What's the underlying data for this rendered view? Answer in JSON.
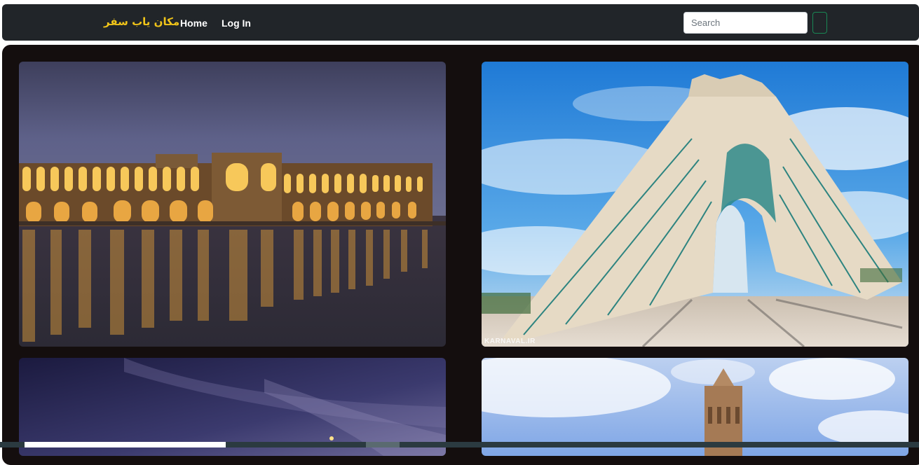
{
  "navbar": {
    "brand": "مکان یاب سفر",
    "links": [
      "Home",
      "Log In"
    ],
    "search": {
      "placeholder": "Search",
      "value": ""
    }
  },
  "gallery": {
    "cards": [
      {
        "icon": "si-o-se-pol-bridge-photo"
      },
      {
        "icon": "azadi-tower-photo",
        "watermark": "KARNAVAL.IR"
      },
      {
        "icon": "night-sky-photo"
      },
      {
        "icon": "minaret-tower-photo"
      }
    ]
  },
  "colors": {
    "navbar_bg": "#212529",
    "brand": "#f0c419",
    "gallery_bg": "#140e0e",
    "search_button_border": "#198754"
  }
}
